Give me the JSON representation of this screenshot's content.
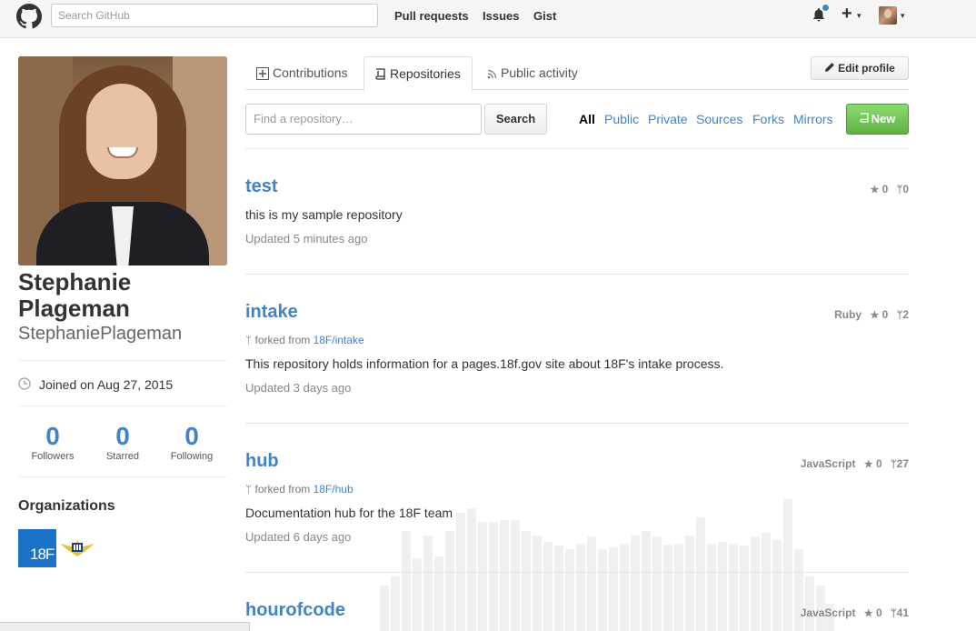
{
  "header": {
    "search_placeholder": "Search GitHub",
    "nav": [
      "Pull requests",
      "Issues",
      "Gist"
    ],
    "plus": "+",
    "caret": "▾"
  },
  "profile": {
    "full_name": "Stephanie Plageman",
    "username": "StephaniePlageman",
    "joined": "Joined on Aug 27, 2015",
    "stats": [
      {
        "value": "0",
        "label": "Followers"
      },
      {
        "value": "0",
        "label": "Starred"
      },
      {
        "value": "0",
        "label": "Following"
      }
    ],
    "orgs_title": "Organizations",
    "org_18f_label": "18F"
  },
  "tabs": [
    {
      "label": "Contributions"
    },
    {
      "label": "Repositories"
    },
    {
      "label": "Public activity"
    }
  ],
  "edit_profile": "Edit profile",
  "filter": {
    "placeholder": "Find a repository…",
    "search_label": "Search",
    "types": [
      "All",
      "Public",
      "Private",
      "Sources",
      "Forks",
      "Mirrors"
    ],
    "new_label": "New"
  },
  "repos": [
    {
      "name": "test",
      "fork_prefix": "",
      "fork_source": "",
      "description": "this is my sample repository",
      "updated": "Updated 5 minutes ago",
      "language": "",
      "stars": "0",
      "forks": "0"
    },
    {
      "name": "intake",
      "fork_prefix": "forked from ",
      "fork_source": "18F/intake",
      "description": "This repository holds information for a pages.18f.gov site about 18F's intake process.",
      "updated": "Updated 3 days ago",
      "language": "Ruby",
      "stars": "0",
      "forks": "2"
    },
    {
      "name": "hub",
      "fork_prefix": "forked from ",
      "fork_source": "18F/hub",
      "description": "Documentation hub for the 18F team",
      "updated": "Updated 6 days ago",
      "language": "JavaScript",
      "stars": "0",
      "forks": "27"
    },
    {
      "name": "hourofcode",
      "fork_prefix": "",
      "fork_source": "",
      "description": "",
      "updated": "",
      "language": "JavaScript",
      "stars": "0",
      "forks": "41"
    }
  ],
  "icons": {
    "star": "★",
    "fork": "ᛘ",
    "fork_small": "ᛘ"
  },
  "colors": {
    "link": "#4183c4",
    "new_button": "#60b044",
    "org_18f": "#1a73c9"
  }
}
